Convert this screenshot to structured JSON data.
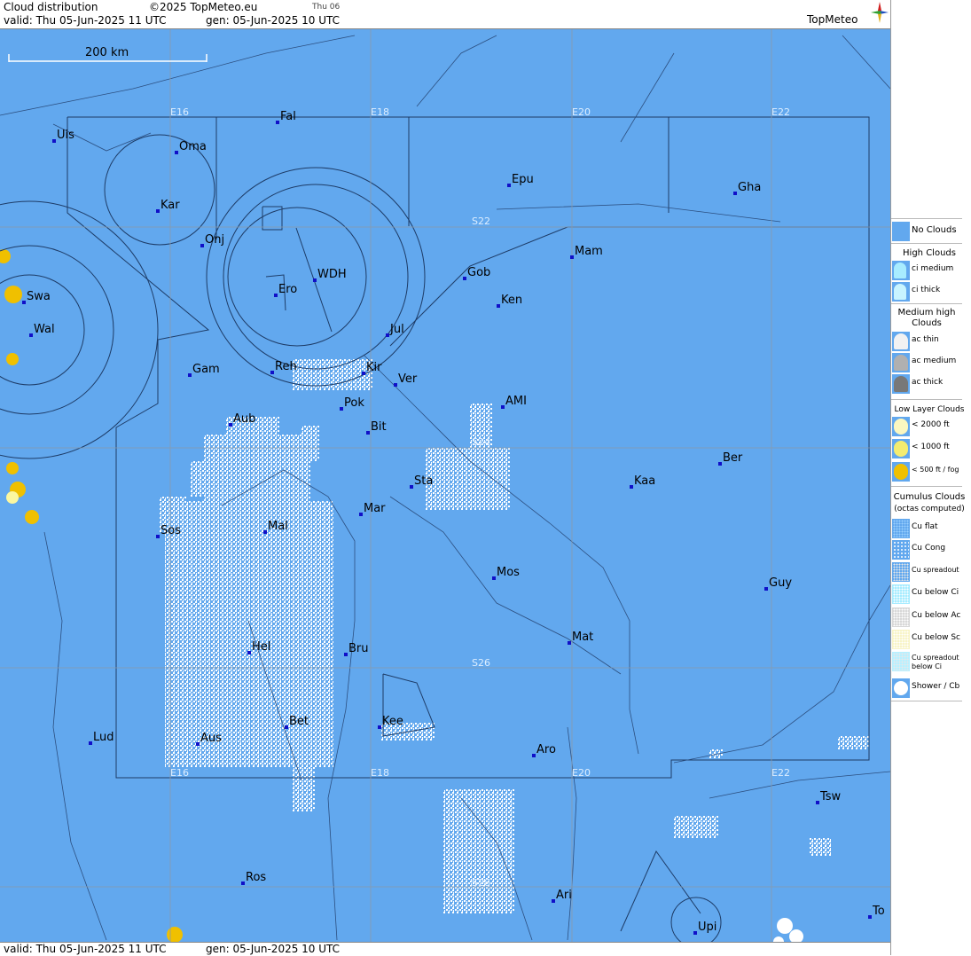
{
  "header": {
    "title": "Cloud distribution",
    "copyright": "©2025 TopMeteo.eu",
    "day": "Thu 06",
    "valid": "valid:  Thu  05-Jun-2025  11 UTC",
    "generated": "gen: 05-Jun-2025 10 UTC",
    "brand": "TopMeteo"
  },
  "footer": {
    "valid": "valid:  Thu  05-Jun-2025  11 UTC",
    "generated": "gen: 05-Jun-2025 10 UTC"
  },
  "map": {
    "scale_label": "200 km",
    "colors": {
      "sea_land": "#62a8ee",
      "cloud": "#ffffff",
      "fog": "#f0c000",
      "lines": "#2a4f7a",
      "grid": "#8a9aaa"
    },
    "grid_labels": {
      "lon_top": [
        "E16",
        "E18",
        "E20",
        "E22"
      ],
      "lon_bottom": [
        "E16",
        "E18",
        "E20",
        "E22"
      ],
      "lat": [
        "S22",
        "S24",
        "S26",
        "S28"
      ]
    },
    "places": [
      {
        "name": "Uis"
      },
      {
        "name": "Fal"
      },
      {
        "name": "Oma"
      },
      {
        "name": "Kar"
      },
      {
        "name": "Epu"
      },
      {
        "name": "Gha"
      },
      {
        "name": "Onj"
      },
      {
        "name": "Mam"
      },
      {
        "name": "Swa"
      },
      {
        "name": "WDH"
      },
      {
        "name": "Gob"
      },
      {
        "name": "Ero"
      },
      {
        "name": "Ken"
      },
      {
        "name": "Wal"
      },
      {
        "name": "Jul"
      },
      {
        "name": "Gam"
      },
      {
        "name": "Reh"
      },
      {
        "name": "Kir"
      },
      {
        "name": "Ver"
      },
      {
        "name": "Aub"
      },
      {
        "name": "Pok"
      },
      {
        "name": "AMI"
      },
      {
        "name": "Bit"
      },
      {
        "name": "Ber"
      },
      {
        "name": "Sta"
      },
      {
        "name": "Kaa"
      },
      {
        "name": "Mar"
      },
      {
        "name": "Sos"
      },
      {
        "name": "Mal"
      },
      {
        "name": "Mos"
      },
      {
        "name": "Guy"
      },
      {
        "name": "Mat"
      },
      {
        "name": "Hel"
      },
      {
        "name": "Bru"
      },
      {
        "name": "Bet"
      },
      {
        "name": "Kee"
      },
      {
        "name": "Lud"
      },
      {
        "name": "Aus"
      },
      {
        "name": "Aro"
      },
      {
        "name": "Tsw"
      },
      {
        "name": "Ros"
      },
      {
        "name": "Ari"
      },
      {
        "name": "Upi"
      },
      {
        "name": "To"
      }
    ]
  },
  "legend": {
    "no_clouds": "No Clouds",
    "high_title": "High Clouds",
    "high": [
      "ci medium",
      "ci thick"
    ],
    "medium_title": "Medium high Clouds",
    "medium": [
      "ac thin",
      "ac medium",
      "ac thick"
    ],
    "low_title": "Low Layer Clouds",
    "low": [
      "< 2000 ft",
      "< 1000 ft",
      "< 500 ft / fog"
    ],
    "cumulus_title": "Cumulus Clouds",
    "cumulus_sub": "(octas computed)",
    "cumulus": [
      "Cu flat",
      "Cu Cong",
      "Cu spreadout",
      "Cu below Ci",
      "Cu below Ac",
      "Cu below Sc",
      "Cu spreadout below Ci",
      "Shower / Cb"
    ]
  }
}
